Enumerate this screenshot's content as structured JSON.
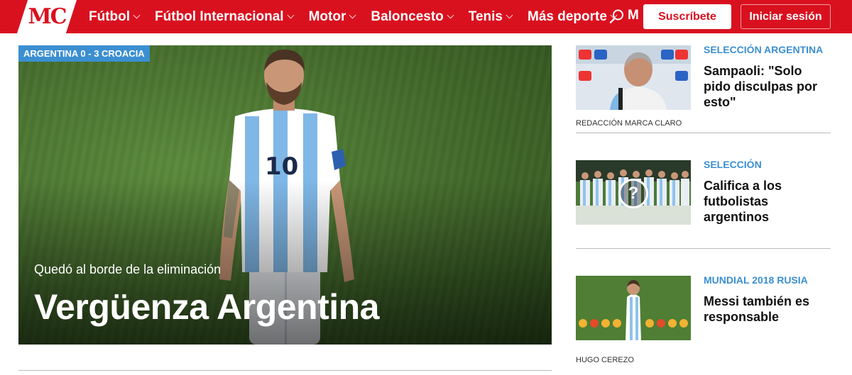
{
  "header": {
    "logo": "MC",
    "nav": [
      {
        "label": "Fútbol"
      },
      {
        "label": "Fútbol Internacional"
      },
      {
        "label": "Motor"
      },
      {
        "label": "Baloncesto"
      },
      {
        "label": "Tenis"
      },
      {
        "label": "Más deporte"
      }
    ],
    "nav_clipped": "M",
    "subscribe_label": "Suscríbete",
    "login_label": "Iniciar sesión"
  },
  "hero": {
    "tag": "ARGENTINA 0 - 3 CROACIA",
    "subtitle": "Quedó al borde de la eliminación",
    "title": "Vergüenza Argentina",
    "shirt_number": "10"
  },
  "sidebar": [
    {
      "kicker": "SELECCIÓN ARGENTINA",
      "headline": "Sampaoli: \"Solo pido disculpas por esto\"",
      "author": "REDACCIÓN MARCA CLARO"
    },
    {
      "kicker": "SELECCIÓN",
      "headline": "Califica a los futbolistas argentinos",
      "author": "",
      "overlay": "?"
    },
    {
      "kicker": "MUNDIAL 2018 RUSIA",
      "headline": "Messi también es responsable",
      "author": "HUGO CEREZO"
    }
  ],
  "colors": {
    "brand_red": "#d9111f",
    "kicker_blue": "#3b8fd1"
  }
}
